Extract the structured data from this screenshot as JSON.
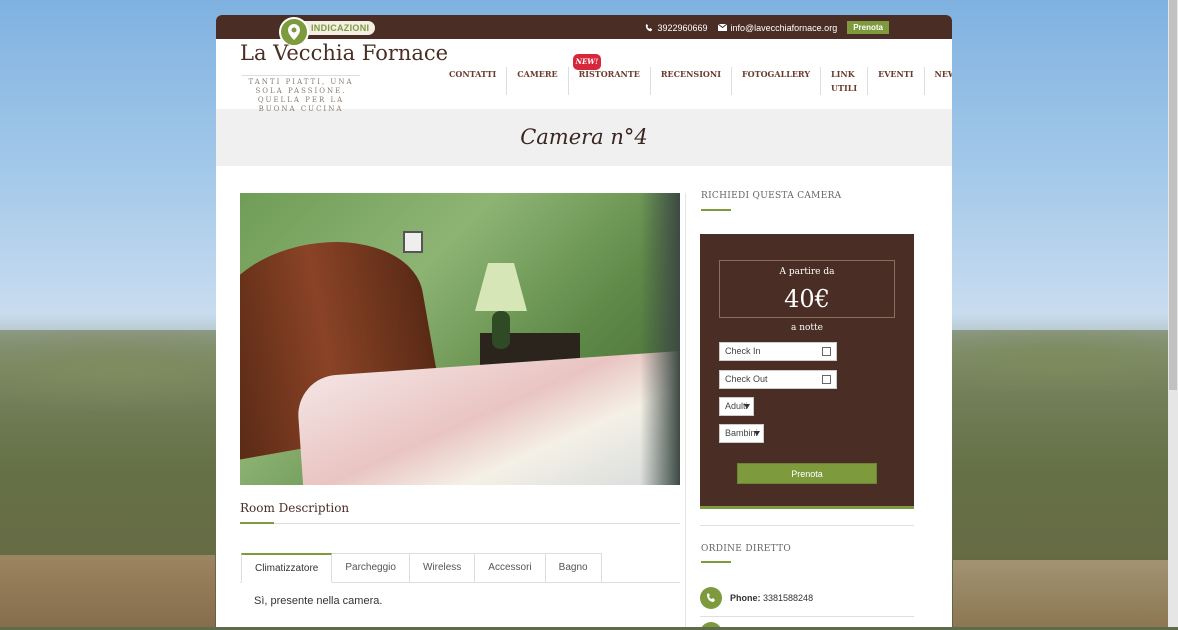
{
  "topbar": {
    "directions_label": "INDICAZIONI",
    "phone": "3922960669",
    "email": "info@lavecchiafornace.org",
    "book_label": "Prenota"
  },
  "header": {
    "title": "La Vecchia Fornace",
    "tagline": "TANTI PIATTI, UNA SOLA PASSIONE. QUELLA PER LA BUONA CUCINA"
  },
  "nav": {
    "items": [
      "CONTATTI",
      "CAMERE",
      "RISTORANTE",
      "RECENSIONI",
      "FOTOGALLERY",
      "LINK UTILI",
      "EVENTI",
      "NEWS"
    ],
    "new_badge": "NEW!"
  },
  "page": {
    "title": "Camera n°4"
  },
  "room": {
    "description_heading": "Room Description",
    "tabs": [
      "Climatizzatore",
      "Parcheggio",
      "Wireless",
      "Accessori",
      "Bagno"
    ],
    "active_tab_content": "Sì, presente nella camera."
  },
  "booking": {
    "heading": "RICHIEDI QUESTA CAMERA",
    "price_from": "A partire da",
    "price": "40€",
    "per_night": "a notte",
    "checkin": "Check In",
    "checkout": "Check Out",
    "adults": "Adulti",
    "children": "Bambini",
    "submit": "Prenota"
  },
  "direct_order": {
    "heading": "ORDINE DIRETTO",
    "phone_label": "Phone:",
    "phone_value": "3381588248"
  },
  "colors": {
    "brown": "#4a2d24",
    "green": "#7d9a3d"
  }
}
